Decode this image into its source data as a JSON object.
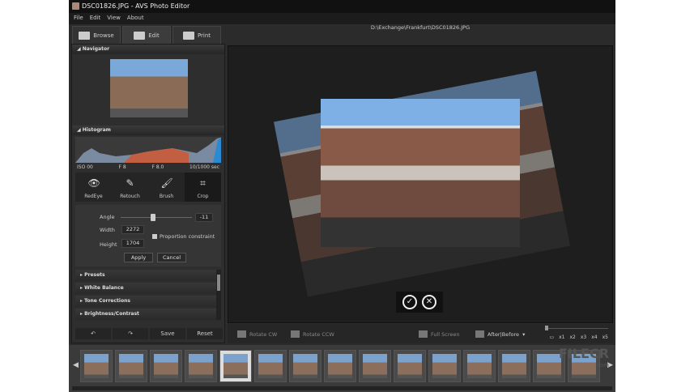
{
  "window": {
    "title": "DSC01826.JPG  -  AVS Photo Editor"
  },
  "menu": [
    "File",
    "Edit",
    "View",
    "About"
  ],
  "tabs": [
    {
      "label": "Browse"
    },
    {
      "label": "Edit"
    },
    {
      "label": "Print"
    }
  ],
  "image_path": "D:\\Exchange\\Frankfurt\\DSC01826.JPG",
  "navigator": {
    "title": "Navigator"
  },
  "histogram": {
    "title": "Histogram",
    "iso": "ISO 00",
    "f1": "F 8",
    "f2": "F 8.0",
    "shutter": "10/1000 sec"
  },
  "tools": [
    {
      "label": "RedEye",
      "icon": "eye"
    },
    {
      "label": "Retouch",
      "icon": "retouch"
    },
    {
      "label": "Brush",
      "icon": "brush"
    },
    {
      "label": "Crop",
      "icon": "crop"
    }
  ],
  "crop": {
    "angle_label": "Angle",
    "angle_value": "-11",
    "angle_slider_fraction": 0.45,
    "width_label": "Width",
    "width_value": "2272",
    "height_label": "Height",
    "height_value": "1704",
    "proportion_label": "Proportion constraint",
    "apply": "Apply",
    "cancel": "Cancel"
  },
  "sections": [
    "Presets",
    "White Balance",
    "Tone Corrections",
    "Brightness/Contrast"
  ],
  "bottom": {
    "save": "Save",
    "reset": "Reset"
  },
  "toolbar": {
    "rotate_cw": "Rotate CW",
    "rotate_ccw": "Rotate CCW",
    "full_screen": "Full Screen",
    "after_before": "After|Before",
    "zoom": [
      "x1",
      "x2",
      "x3",
      "x4",
      "x5"
    ]
  },
  "watermark": {
    "text": "FILECR",
    "sub": ".com"
  }
}
